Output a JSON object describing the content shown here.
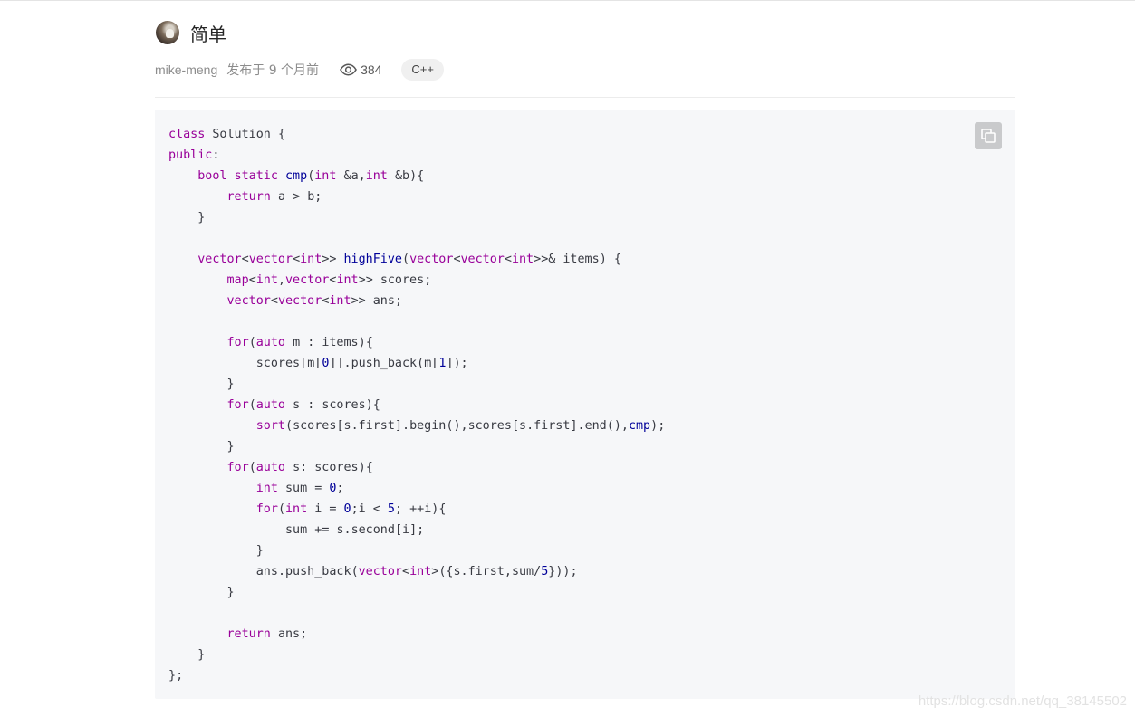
{
  "header": {
    "title": "简单",
    "author": "mike-meng",
    "published": "发布于 9 个月前",
    "views": "384",
    "tag": "C++"
  },
  "code": {
    "language": "C++",
    "copy_icon": "copy-icon",
    "lines": [
      "class Solution {",
      "public:",
      "    bool static cmp(int &a,int &b){",
      "        return a > b;",
      "    }",
      "",
      "    vector<vector<int>> highFive(vector<vector<int>>& items) {",
      "        map<int,vector<int>> scores;",
      "        vector<vector<int>> ans;",
      "",
      "        for(auto m : items){",
      "            scores[m[0]].push_back(m[1]);",
      "        }",
      "        for(auto s : scores){",
      "            sort(scores[s.first].begin(),scores[s.first].end(),cmp);",
      "        }",
      "        for(auto s: scores){",
      "            int sum = 0;",
      "            for(int i = 0;i < 5; ++i){",
      "                sum += s.second[i];",
      "            }",
      "            ans.push_back(vector<int>({s.first,sum/5}));",
      "        }",
      "",
      "        return ans;",
      "    }",
      "};"
    ]
  },
  "watermark": "https://blog.csdn.net/qq_38145502",
  "colors": {
    "keyword": "#990099",
    "function": "#000099",
    "code_background": "#f6f7f9",
    "tag_background": "#f0f0f0"
  }
}
